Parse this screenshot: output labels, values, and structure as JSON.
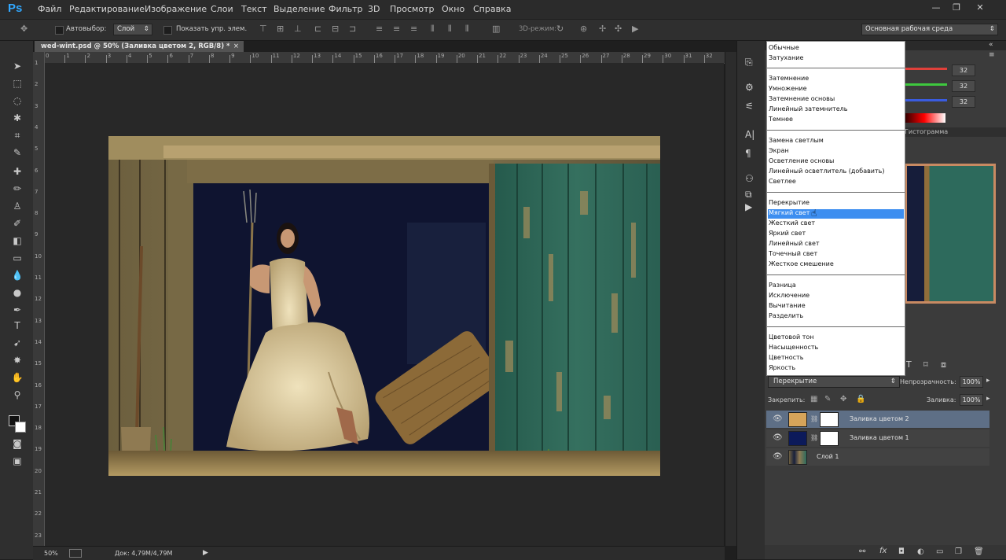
{
  "app": {
    "logo": "Ps"
  },
  "menu": [
    "Файл",
    "Редактирование",
    "Изображение",
    "Слои",
    "Текст",
    "Выделение",
    "Фильтр",
    "3D",
    "Просмотр",
    "Окно",
    "Справка"
  ],
  "window_controls": {
    "minimize": "—",
    "restore": "❐",
    "close": "✕"
  },
  "options": {
    "autoselect_label": "Автовыбор:",
    "autoselect_value": "Слой",
    "show_controls_label": "Показать упр. элем.",
    "mode_3d_label": "3D-режим:",
    "workspace": "Основная рабочая среда"
  },
  "document": {
    "tab_title": "wed-wint.psd @ 50% (Заливка цветом 2, RGB/8) *",
    "tab_close": "×",
    "ruler_top_labels": [
      "0",
      "1",
      "2",
      "3",
      "4",
      "5",
      "6",
      "7",
      "8",
      "9",
      "10",
      "11",
      "12",
      "13",
      "14",
      "15",
      "16",
      "17",
      "18",
      "19",
      "20",
      "21",
      "22",
      "23",
      "24",
      "25",
      "26",
      "27",
      "28",
      "29",
      "30",
      "31",
      "32"
    ],
    "ruler_left_labels": [
      "1",
      "2",
      "3",
      "4",
      "5",
      "6",
      "7",
      "8",
      "9",
      "10",
      "11",
      "12",
      "13",
      "14",
      "15",
      "16",
      "17",
      "18",
      "19",
      "20",
      "21",
      "22",
      "23"
    ],
    "zoom": "50%",
    "doc_info": "Док: 4,79M/4,79M"
  },
  "blend_menu": {
    "groups": [
      [
        "Обычные",
        "Затухание"
      ],
      [
        "Затемнение",
        "Умножение",
        "Затемнение основы",
        "Линейный затемнитель",
        "Темнее"
      ],
      [
        "Замена светлым",
        "Экран",
        "Осветление основы",
        "Линейный осветлитель (добавить)",
        "Светлее"
      ],
      [
        "Перекрытие",
        "Мягкий свет",
        "Жесткий свет",
        "Яркий свет",
        "Линейный свет",
        "Точечный свет",
        "Жесткое смешение"
      ],
      [
        "Разница",
        "Исключение",
        "Вычитание",
        "Разделить"
      ],
      [
        "Цветовой тон",
        "Насыщенность",
        "Цветность",
        "Яркость"
      ]
    ],
    "highlighted": "Мягкий свет"
  },
  "color_panel": {
    "r": "32",
    "g": "32",
    "b": "32"
  },
  "histogram_tab": "Гистограмма",
  "layers_panel": {
    "blend_mode": "Перекрытие",
    "opacity_label": "Непрозрачность:",
    "opacity_value": "100%",
    "lock_label": "Закрепить:",
    "fill_label": "Заливка:",
    "fill_value": "100%",
    "layers": [
      {
        "name": "Заливка цветом 2",
        "color": "#d6a45a",
        "selected": true
      },
      {
        "name": "Заливка цветом 1",
        "color": "#0c1a5a",
        "selected": false
      },
      {
        "name": "Слой 1",
        "color": "#4a3a25",
        "selected": false
      }
    ],
    "bottom_icons": [
      "link-icon",
      "fx-icon",
      "mask-icon",
      "adjustment-icon",
      "group-icon",
      "new-layer-icon",
      "trash-icon"
    ]
  },
  "colors": {
    "accent": "#3d8ef0",
    "photo_ground": "#9a8450",
    "barn_green": "#2f6659",
    "barn_dark": "#0f1430",
    "dress": "#d9c79b"
  }
}
